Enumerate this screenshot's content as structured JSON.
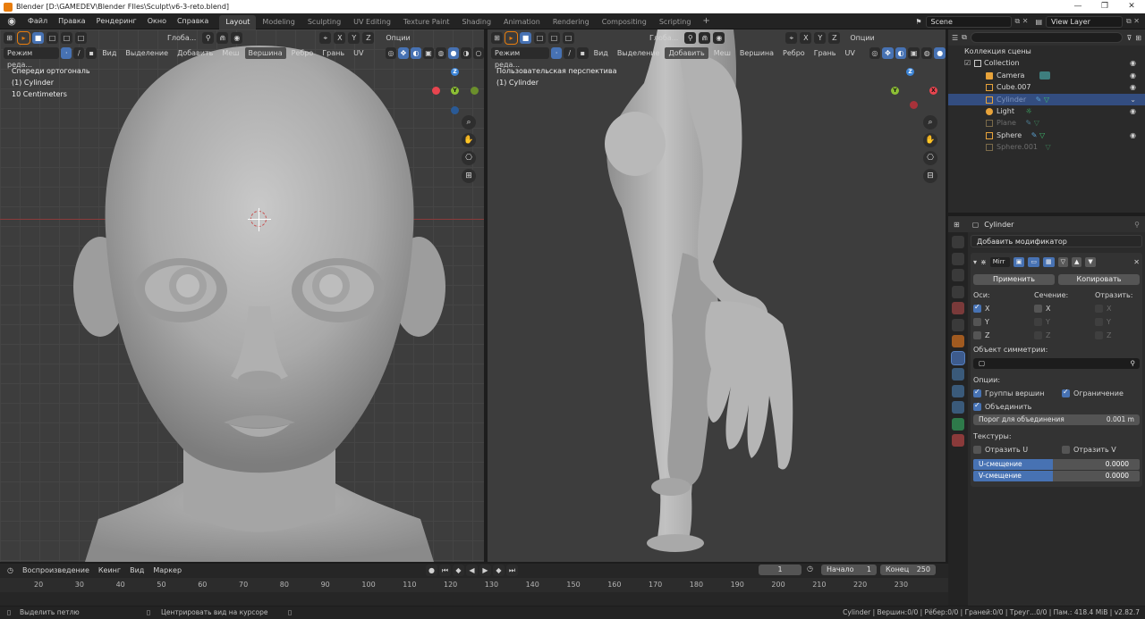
{
  "titlebar": {
    "title": "Blender [D:\\GAMEDEV\\Blender FIles\\Sculpt\\v6-3-reto.blend]"
  },
  "menu": [
    "Файл",
    "Правка",
    "Рендеринг",
    "Окно",
    "Справка"
  ],
  "workspaces": [
    "Layout",
    "Modeling",
    "Sculpting",
    "UV Editing",
    "Texture Paint",
    "Shading",
    "Animation",
    "Rendering",
    "Compositing",
    "Scripting"
  ],
  "active_workspace": "Layout",
  "scene": "Scene",
  "view_layer": "View Layer",
  "viewport_left": {
    "mode": "Режим реда...",
    "transform": "Глоба...",
    "options": "Опции",
    "axes": [
      "X",
      "Y",
      "Z"
    ],
    "menus": [
      "Вид",
      "Выделение",
      "Добавить",
      "Меш",
      "Вершина",
      "Ребро",
      "Грань",
      "UV"
    ],
    "info": [
      "Спереди ортогональ",
      "(1) Cylinder",
      "10 Centimeters"
    ]
  },
  "viewport_right": {
    "mode": "Режим реда...",
    "transform": "Глоба...",
    "options": "Опции",
    "axes": [
      "X",
      "Y",
      "Z"
    ],
    "menus": [
      "Вид",
      "Выделение",
      "Добавить",
      "Меш",
      "Вершина",
      "Ребро",
      "Грань",
      "UV"
    ],
    "info": [
      "Пользовательская перспектива",
      "(1) Cylinder"
    ]
  },
  "gizmo_labels": {
    "x": "X",
    "y": "Y",
    "z": "Z"
  },
  "outliner": {
    "title": "Коллекция сцены",
    "items": [
      {
        "label": "Collection",
        "dim": false,
        "selected": false
      },
      {
        "label": "Camera",
        "dim": false,
        "selected": false
      },
      {
        "label": "Cube.007",
        "dim": false,
        "selected": false
      },
      {
        "label": "Cylinder",
        "dim": false,
        "selected": true
      },
      {
        "label": "Light",
        "dim": false,
        "selected": false
      },
      {
        "label": "Plane",
        "dim": true,
        "selected": false
      },
      {
        "label": "Sphere",
        "dim": false,
        "selected": false
      },
      {
        "label": "Sphere.001",
        "dim": true,
        "selected": false
      }
    ]
  },
  "properties": {
    "object": "Cylinder",
    "add_modifier": "Добавить модификатор",
    "modifier_name": "Mirr",
    "apply": "Применить",
    "copy": "Копировать",
    "axes_label": "Оси:",
    "bisect_label": "Сечение:",
    "flip_label": "Отразить:",
    "axis_x": "X",
    "axis_y": "Y",
    "axis_z": "Z",
    "mirror_object_label": "Объект симметрии:",
    "options_label": "Опции:",
    "vertex_groups": "Группы вершин",
    "clipping": "Ограничение",
    "merge": "Объединить",
    "merge_threshold_label": "Порог для объединения",
    "merge_threshold_value": "0.001 m",
    "textures_label": "Текстуры:",
    "flip_u": "Отразить U",
    "flip_v": "Отразить V",
    "u_offset_label": "U-смещение",
    "u_offset_value": "0.0000",
    "v_offset_label": "V-смещение",
    "v_offset_value": "0.0000"
  },
  "timeline": {
    "playback": "Воспроизведение",
    "keying": "Кеинг",
    "view": "Вид",
    "marker": "Маркер",
    "current_frame": "1",
    "start_label": "Начало",
    "start_value": "1",
    "end_label": "Конец",
    "end_value": "250",
    "ticks": [
      "20",
      "30",
      "40",
      "50",
      "60",
      "70",
      "80",
      "90",
      "100",
      "110",
      "120",
      "130",
      "140",
      "150",
      "160",
      "170",
      "180",
      "190",
      "200",
      "210",
      "220",
      "230"
    ]
  },
  "statusbar": {
    "left": "Выделить петлю",
    "middle": "Центрировать вид на курсоре",
    "right": "Cylinder | Вершин:0/0 | Рёбер:0/0 | Граней:0/0 | Треуг...0/0 | Пам.: 418.4 MiB | v2.82.7"
  },
  "colors": {
    "accent": "#4772b3",
    "selected_row": "#334d80",
    "viewport_bg": "#3d3d3d",
    "x_axis": "#e8454f",
    "y_axis": "#8dbf35",
    "z_axis": "#3c84d6"
  }
}
